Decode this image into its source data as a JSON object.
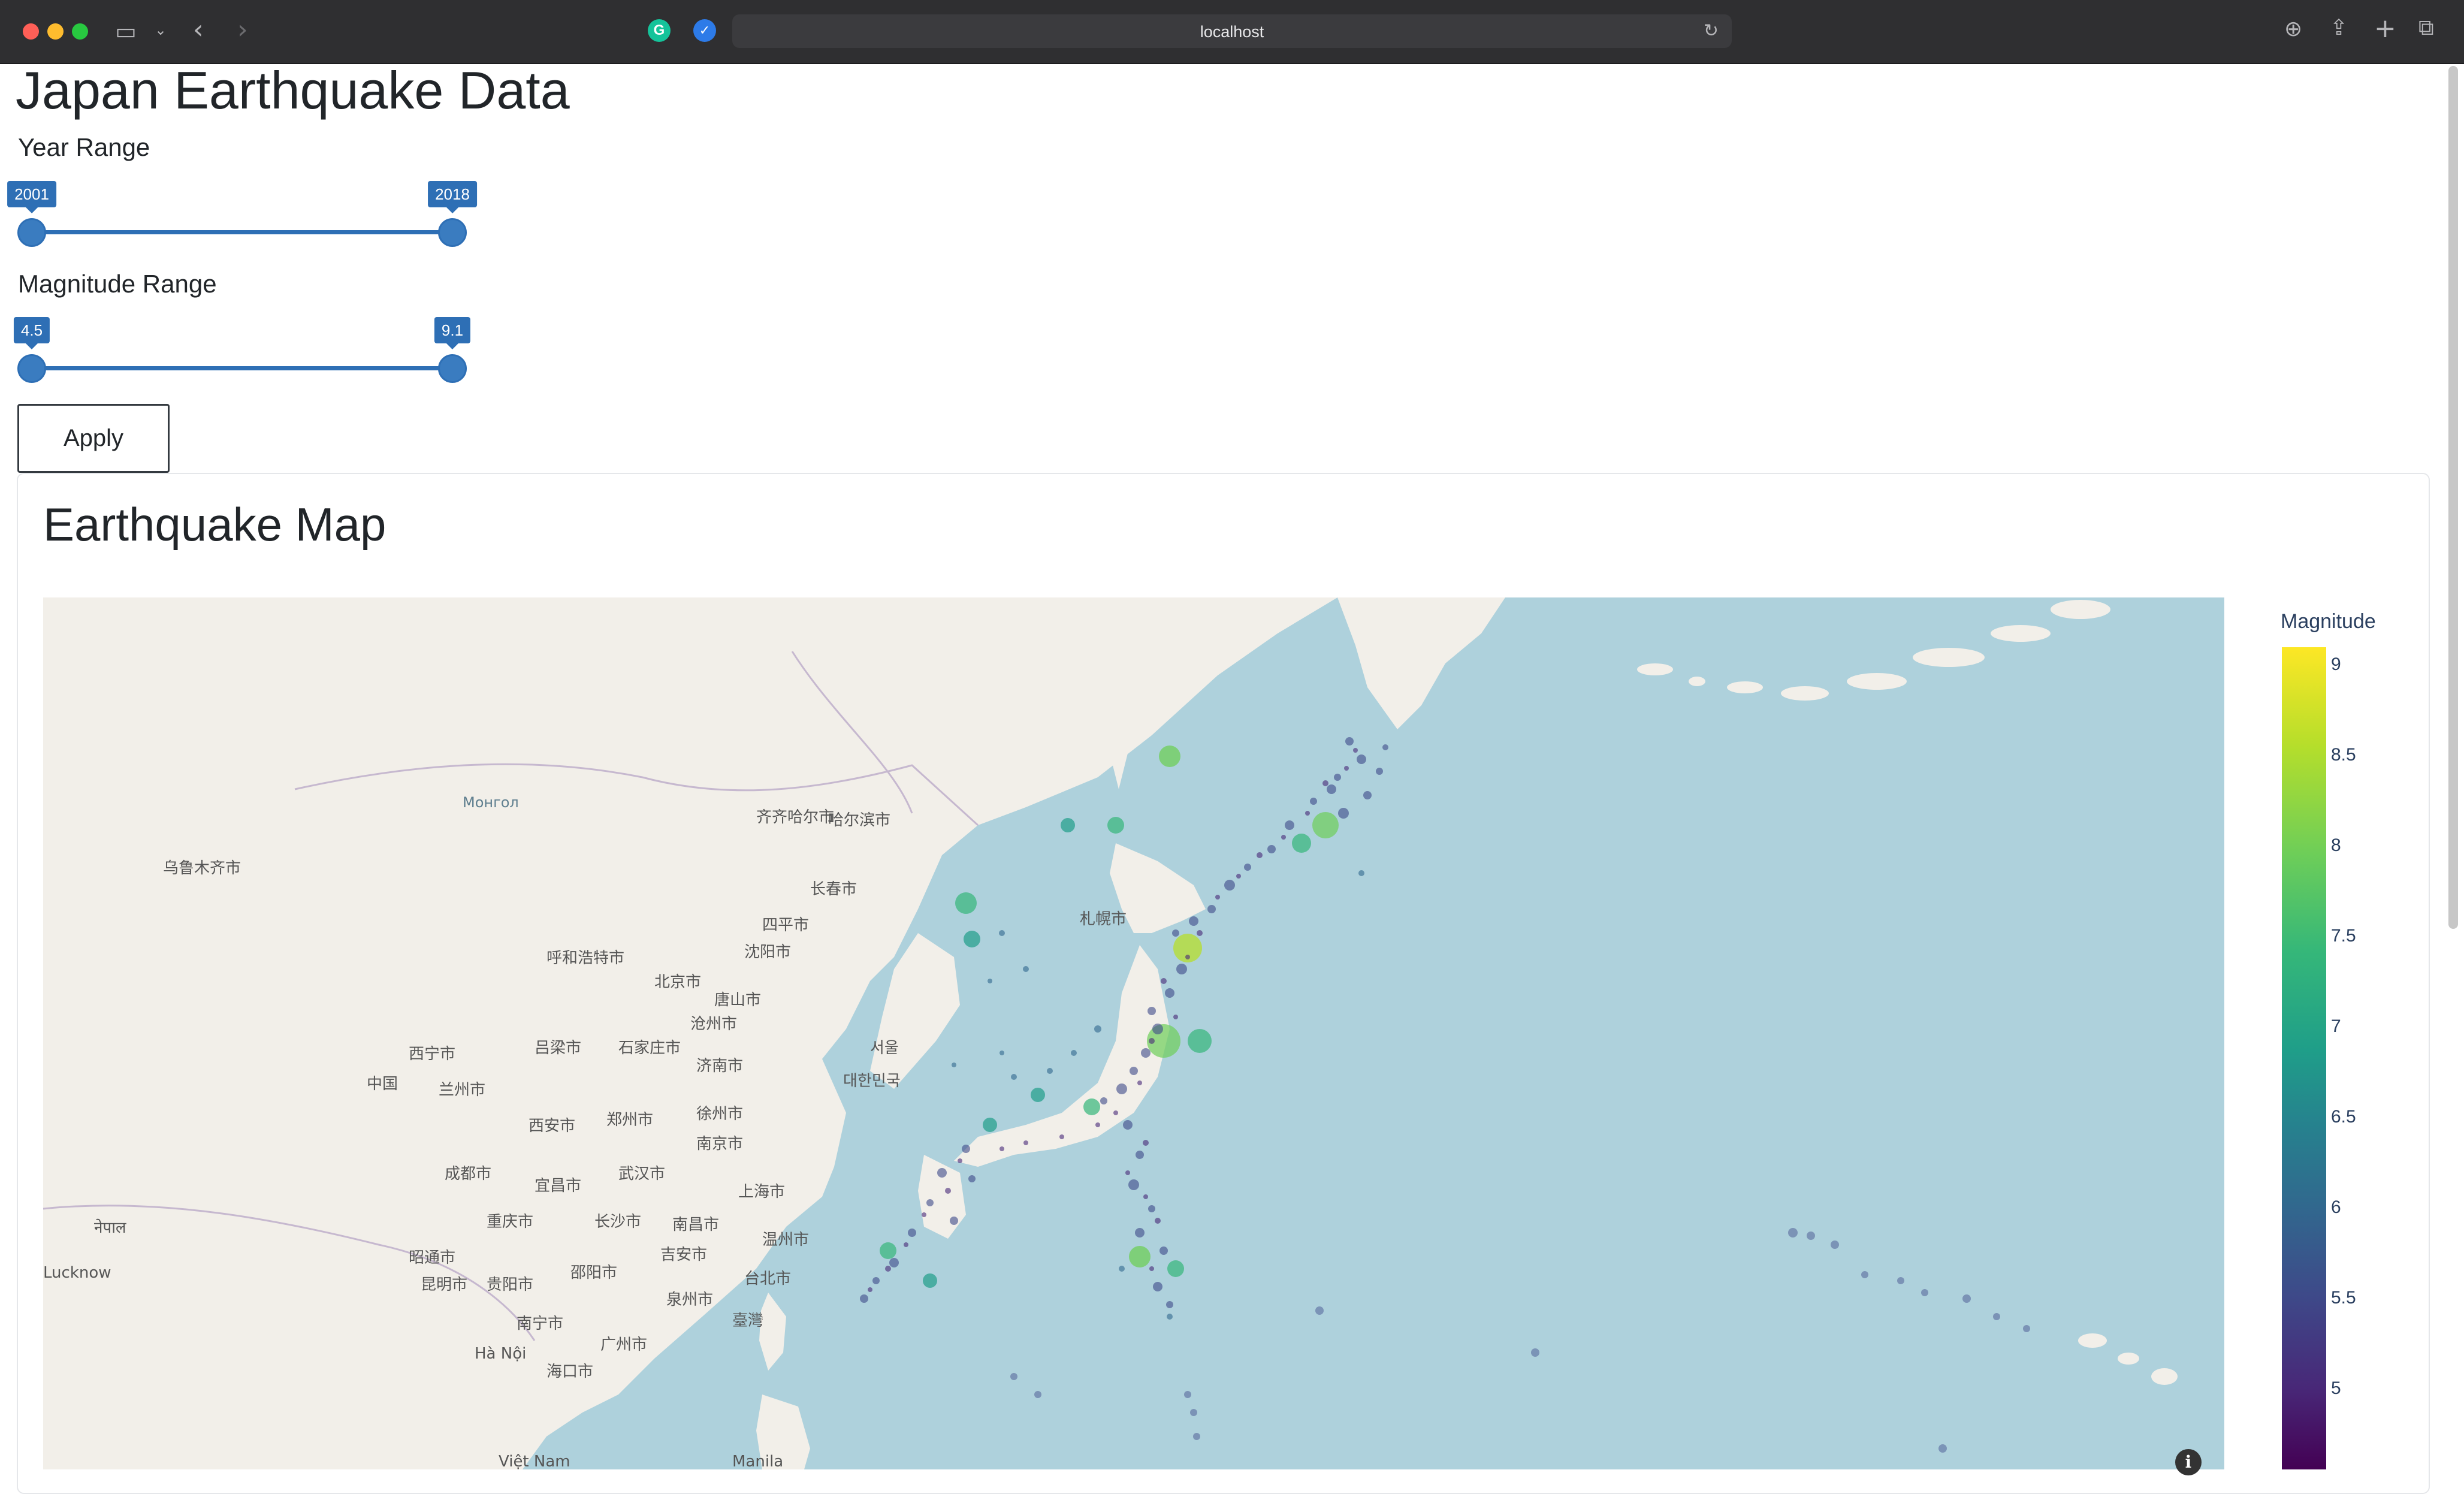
{
  "browser": {
    "url": "localhost"
  },
  "page": {
    "title": "Japan Earthquake Data"
  },
  "controls": {
    "year_range": {
      "label": "Year Range",
      "min_label": "2001",
      "max_label": "2018",
      "selected": [
        2001,
        2018
      ]
    },
    "magnitude_range": {
      "label": "Magnitude Range",
      "min_label": "4.5",
      "max_label": "9.1",
      "selected": [
        4.5,
        9.1
      ]
    },
    "apply_label": "Apply"
  },
  "map_card": {
    "title": "Earthquake Map",
    "colorbar": {
      "title": "Magnitude",
      "ticks": [
        "9",
        "8.5",
        "8",
        "7.5",
        "7",
        "6.5",
        "6",
        "5.5",
        "5"
      ],
      "colorscale": "viridis"
    },
    "map_labels": [
      "Монгол",
      "乌鲁木齐市",
      "齐齐哈尔市",
      "哈尔滨市",
      "长春市",
      "四平市",
      "沈阳市",
      "呼和浩特市",
      "北京市",
      "唐山市",
      "沧州市",
      "石家庄市",
      "济南市",
      "吕梁市",
      "西宁市",
      "兰州市",
      "中国",
      "西安市",
      "郑州市",
      "徐州市",
      "南京市",
      "上海市",
      "成都市",
      "宜昌市",
      "武汉市",
      "重庆市",
      "长沙市",
      "南昌市",
      "温州市",
      "吉安市",
      "昭通市",
      "昆明市",
      "贵阳市",
      "邵阳市",
      "泉州市",
      "台北市",
      "臺灣",
      "南宁市",
      "广州市",
      "海口市",
      "札幌市",
      "서울",
      "대한민국",
      "Lucknow",
      "Hà Nội",
      "Việt Nam",
      "Manila",
      "नेपाल"
    ]
  }
}
